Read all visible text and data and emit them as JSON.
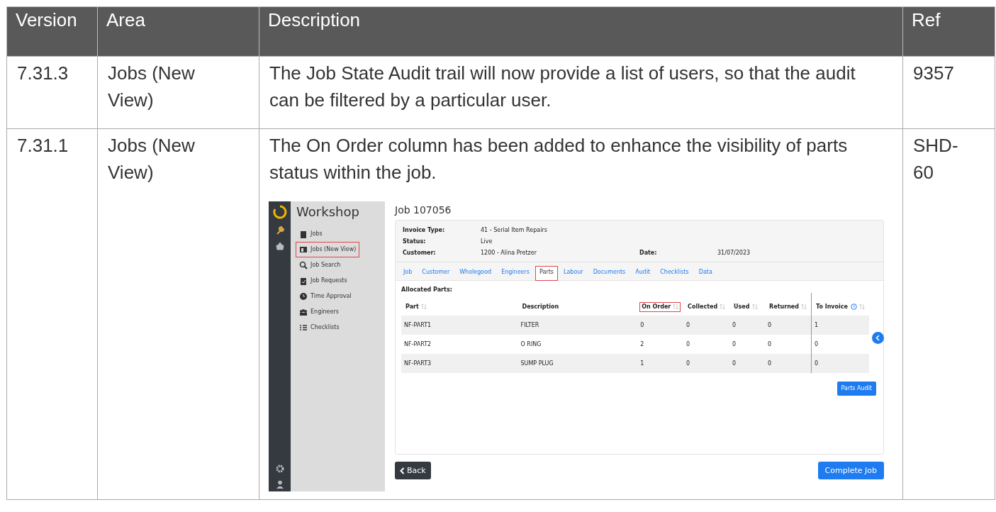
{
  "table": {
    "columns": [
      "Version",
      "Area",
      "Description",
      "Ref"
    ],
    "rows": [
      {
        "version": "7.31.3",
        "area": "Jobs (New View)",
        "description": "The Job State Audit trail will now provide a list of users, so that the audit can be filtered by a particular user.",
        "ref": "9357"
      },
      {
        "version": "7.31.1",
        "area": "Jobs (New View)",
        "description": "The On Order column has been added to enhance the visibility of parts status within the job.",
        "ref": "SHD-60",
        "screenshot": {
          "app_title": "Workshop",
          "sidebar_items": [
            {
              "label": "Jobs",
              "highlighted": false
            },
            {
              "label": "Jobs (New View)",
              "highlighted": true
            },
            {
              "label": "Job Search",
              "highlighted": false
            },
            {
              "label": "Job Requests",
              "highlighted": false
            },
            {
              "label": "Time Approval",
              "highlighted": false
            },
            {
              "label": "Engineers",
              "highlighted": false
            },
            {
              "label": "Checklists",
              "highlighted": false
            }
          ],
          "page_title": "Job 107056",
          "info": [
            [
              {
                "label": "Invoice Type:",
                "value": "41 - Serial Item Repairs"
              }
            ],
            [
              {
                "label": "Status:",
                "value": "Live"
              }
            ],
            [
              {
                "label": "Customer:",
                "value": "1200 - Alina Pretzer"
              },
              {
                "label": "Date:",
                "value": "31/07/2023"
              }
            ]
          ],
          "tabs": [
            {
              "label": "Job",
              "selected": false,
              "highlighted": false
            },
            {
              "label": "Customer",
              "selected": false,
              "highlighted": false
            },
            {
              "label": "Wholegood",
              "selected": false,
              "highlighted": false
            },
            {
              "label": "Engineers",
              "selected": false,
              "highlighted": false
            },
            {
              "label": "Parts",
              "selected": true,
              "highlighted": true
            },
            {
              "label": "Labour",
              "selected": false,
              "highlighted": false
            },
            {
              "label": "Documents",
              "selected": false,
              "highlighted": false
            },
            {
              "label": "Audit",
              "selected": false,
              "highlighted": false
            },
            {
              "label": "Checklists",
              "selected": false,
              "highlighted": false
            },
            {
              "label": "Data",
              "selected": false,
              "highlighted": false
            }
          ],
          "section_title": "Allocated Parts:",
          "columns": [
            {
              "label": "Part",
              "sortable": true,
              "highlighted": false,
              "help": false
            },
            {
              "label": "Description",
              "sortable": false,
              "highlighted": false,
              "help": false
            },
            {
              "label": "On Order",
              "sortable": true,
              "highlighted": true,
              "help": false
            },
            {
              "label": "Collected",
              "sortable": true,
              "highlighted": false,
              "help": false
            },
            {
              "label": "Used",
              "sortable": true,
              "highlighted": false,
              "help": false
            },
            {
              "label": "Returned",
              "sortable": true,
              "highlighted": false,
              "help": false
            },
            {
              "label": "To Invoice",
              "sortable": true,
              "highlighted": false,
              "help": true
            }
          ],
          "rows": [
            [
              "NF-PART1",
              "FILTER",
              "0",
              "0",
              "0",
              "0",
              "1"
            ],
            [
              "NF-PART2",
              "O RING",
              "2",
              "0",
              "0",
              "0",
              "0"
            ],
            [
              "NF-PART3",
              "SUMP PLUG",
              "1",
              "0",
              "0",
              "0",
              "0"
            ]
          ],
          "parts_audit_button": "Parts Audit",
          "back_button": "Back",
          "complete_button": "Complete Job"
        }
      }
    ]
  }
}
